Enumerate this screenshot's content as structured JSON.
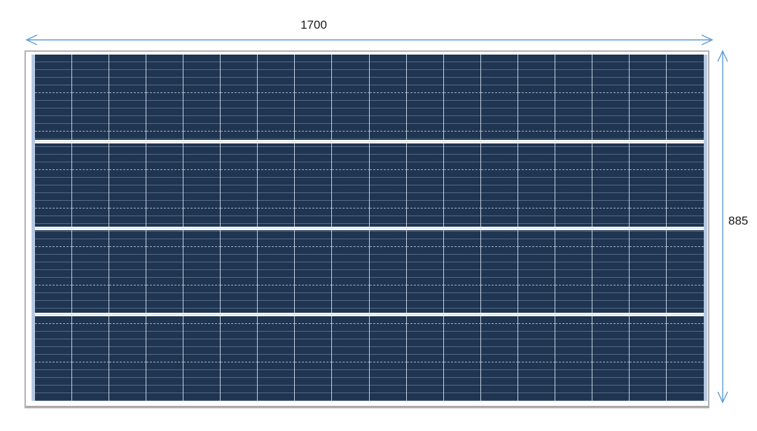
{
  "diagram": {
    "type": "solar-panel-dimension-drawing",
    "width_dimension": {
      "label": "1700"
    },
    "height_dimension": {
      "label": "885"
    }
  },
  "panel": {
    "columns": 18,
    "rows": 9,
    "sections": 4,
    "busbar_bands_count": 3
  },
  "colors": {
    "background": "#ffffff",
    "dimension_line": "#5b9bd5",
    "dimension_text": "#1a1a1a",
    "cell_fill": "#1f3551",
    "busbar_line": "rgba(125,150,180,0.55)",
    "cell_divider_dashed": "rgba(165,185,210,0.95)",
    "column_line": "rgba(206,217,231,0.95)",
    "edge_strip": "#b7c9e2",
    "frame_fill": "#ffffff",
    "frame_border": "#b3b3b3"
  }
}
